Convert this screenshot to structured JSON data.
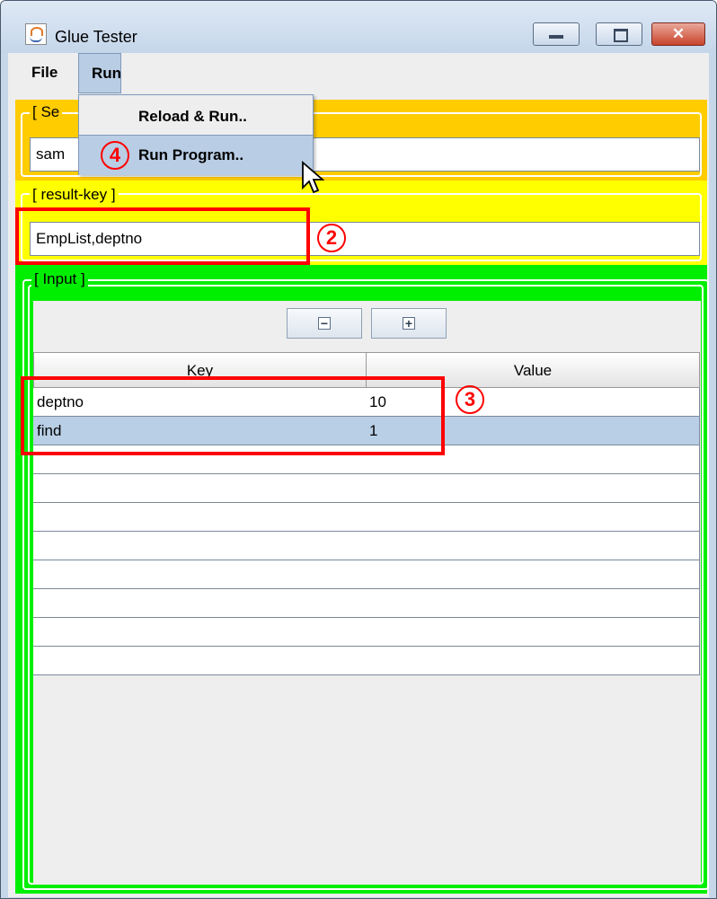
{
  "window": {
    "title": "Glue Tester",
    "minimize_glyph": "—",
    "maximize_glyph": "▭",
    "close_glyph": "✕"
  },
  "menubar": {
    "file": "File",
    "run": "Run"
  },
  "run_menu": {
    "items": [
      "Reload & Run..",
      "Run Program.."
    ],
    "highlighted_index": 1
  },
  "select_panel": {
    "title_visible": "[ Se",
    "value_visible": "sam"
  },
  "result_key_panel": {
    "title": "[ result-key ]",
    "value": "EmpList,deptno"
  },
  "input_panel": {
    "title": "[ Input ]",
    "remove_glyph": "−",
    "add_glyph": "+",
    "columns": [
      "Key",
      "Value"
    ],
    "rows": [
      {
        "key": "deptno",
        "value": "10"
      },
      {
        "key": "find",
        "value": "1"
      },
      {
        "key": "",
        "value": ""
      },
      {
        "key": "",
        "value": ""
      },
      {
        "key": "",
        "value": ""
      },
      {
        "key": "",
        "value": ""
      },
      {
        "key": "",
        "value": ""
      },
      {
        "key": "",
        "value": ""
      },
      {
        "key": "",
        "value": ""
      },
      {
        "key": "",
        "value": ""
      }
    ],
    "selected_row": 1
  },
  "annotations": {
    "marker_2": "2",
    "marker_3": "3",
    "marker_4": "4"
  },
  "colors": {
    "select_panel": "#ffcc00",
    "result_panel": "#ffff00",
    "input_panel": "#00ee00",
    "annotation": "#ff0000",
    "selection": "#b8cfe5"
  }
}
